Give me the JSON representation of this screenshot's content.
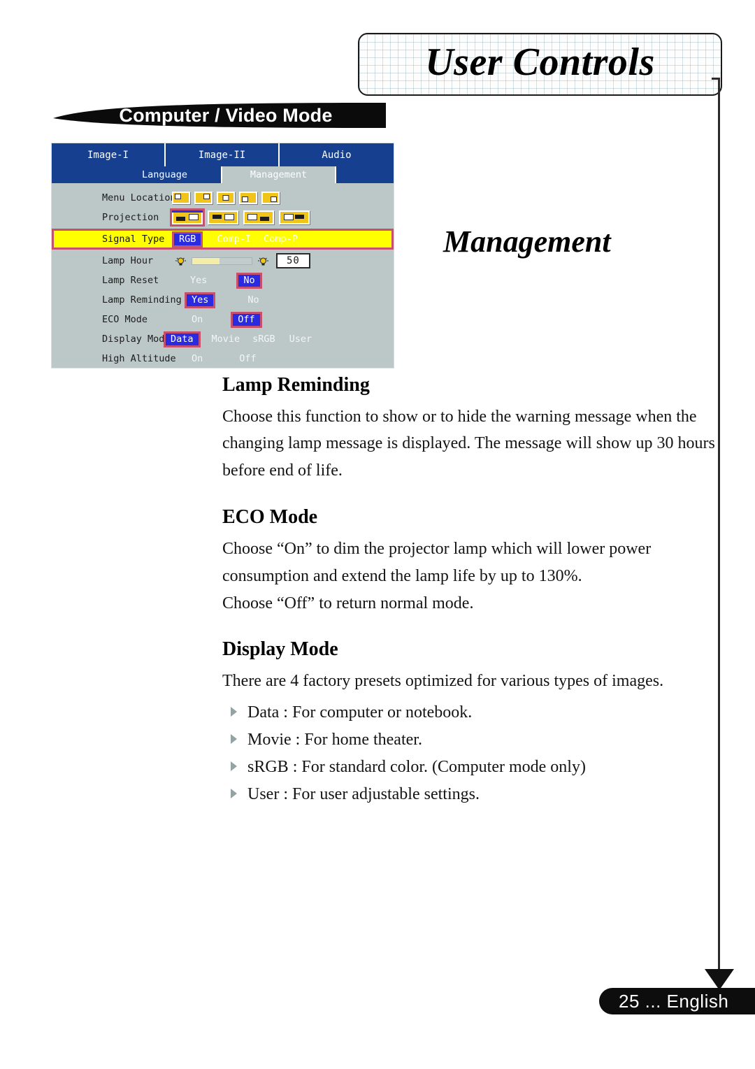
{
  "header": {
    "title": "User Controls"
  },
  "banner": {
    "label": "Computer / Video Mode"
  },
  "section": {
    "title": "Management"
  },
  "osd": {
    "tabs_row1": [
      {
        "label": "Image-I",
        "active": false
      },
      {
        "label": "Image-II",
        "active": false
      },
      {
        "label": "Audio",
        "active": false
      }
    ],
    "tabs_row2": [
      {
        "label": "Language",
        "active": false
      },
      {
        "label": "Management",
        "active": true
      }
    ],
    "rows": [
      {
        "label": "Menu Location",
        "type": "icons-location"
      },
      {
        "label": "Projection",
        "type": "icons-projection"
      },
      {
        "label": "Signal Type",
        "type": "options",
        "highlighted": true,
        "options": [
          {
            "text": "RGB",
            "selected": true
          },
          {
            "text": "Comp-I",
            "selected": false
          },
          {
            "text": "Comp-P",
            "selected": false
          }
        ]
      },
      {
        "label": "Lamp Hour",
        "type": "slider",
        "value": "50"
      },
      {
        "label": "Lamp Reset",
        "type": "options",
        "options": [
          {
            "text": "Yes",
            "selected": false
          },
          {
            "text": "No",
            "selected": true
          }
        ]
      },
      {
        "label": "Lamp Reminding",
        "type": "options",
        "options": [
          {
            "text": "Yes",
            "selected": true
          },
          {
            "text": "No",
            "selected": false
          }
        ]
      },
      {
        "label": "ECO Mode",
        "type": "options",
        "options": [
          {
            "text": "On",
            "selected": false
          },
          {
            "text": "Off",
            "selected": true
          }
        ]
      },
      {
        "label": "Display Mode",
        "type": "options",
        "options": [
          {
            "text": "Data",
            "selected": true
          },
          {
            "text": "Movie",
            "selected": false
          },
          {
            "text": "sRGB",
            "selected": false
          },
          {
            "text": "User",
            "selected": false
          }
        ]
      },
      {
        "label": "High Altitude",
        "type": "options",
        "options": [
          {
            "text": "On",
            "selected": false
          },
          {
            "text": "Off",
            "selected": false
          }
        ]
      }
    ],
    "colors": {
      "tab_blue": "#16408f",
      "body_gray": "#bcc7c7",
      "selected_blue": "#2a2ae0",
      "selection_border": "#c4526e",
      "highlight_yellow": "#ffff00",
      "icon_yellow": "#f0c419"
    }
  },
  "content": {
    "lamp_reminding": {
      "heading": "Lamp Reminding",
      "body": "Choose this function to show or to hide the warning message when the changing lamp message is displayed.  The message will show up 30 hours before end of life."
    },
    "eco_mode": {
      "heading": "ECO Mode",
      "body1": "Choose “On” to dim the projector lamp which will lower power consumption and extend the lamp life by up to 130%.",
      "body2": "Choose “Off” to return normal mode."
    },
    "display_mode": {
      "heading": "Display Mode",
      "body": "There are 4 factory presets optimized for various types of images.",
      "bullets": [
        "Data : For computer or notebook.",
        "Movie : For home theater.",
        "sRGB : For standard color. (Computer mode only)",
        "User : For user adjustable settings."
      ]
    }
  },
  "footer": {
    "text": "25  ... English"
  }
}
